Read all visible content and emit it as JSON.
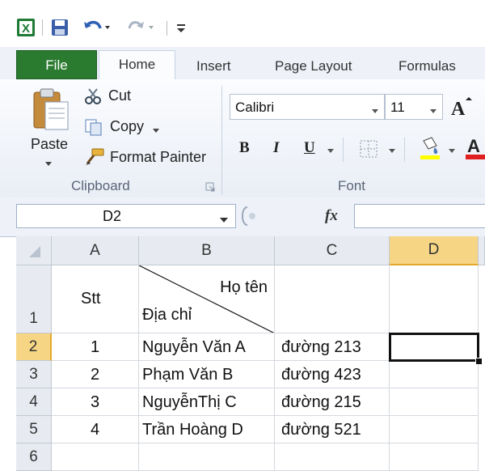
{
  "quick_access": {
    "icons": [
      "excel-icon",
      "save-icon",
      "undo-icon",
      "redo-icon",
      "customize-icon"
    ]
  },
  "tabs": [
    {
      "label": "File"
    },
    {
      "label": "Home"
    },
    {
      "label": "Insert"
    },
    {
      "label": "Page Layout"
    },
    {
      "label": "Formulas"
    }
  ],
  "ribbon": {
    "clipboard": {
      "paste": "Paste",
      "cut": "Cut",
      "copy": "Copy",
      "format_painter": "Format Painter",
      "label": "Clipboard"
    },
    "font": {
      "name": "Calibri",
      "size": "11",
      "bold": "B",
      "italic": "I",
      "underline": "U",
      "label": "Font"
    }
  },
  "formula_bar": {
    "name_box": "D2",
    "fx": "fx",
    "value": ""
  },
  "sheet": {
    "columns": [
      "A",
      "B",
      "C",
      "D"
    ],
    "rows": [
      "1",
      "2",
      "3",
      "4",
      "5",
      "6"
    ],
    "header_row": {
      "stt": "Stt",
      "ho_ten": "Họ tên",
      "dia_chi": "Địa chỉ",
      "c": "",
      "d": ""
    },
    "data": [
      {
        "stt": "1",
        "name": "Nguyễn Văn A",
        "address": "đường 213"
      },
      {
        "stt": "2",
        "name": "Phạm Văn B",
        "address": "đường 423"
      },
      {
        "stt": "3",
        "name": "NguyễnThị C",
        "address": "đường 215"
      },
      {
        "stt": "4",
        "name": "Trần Hoàng D",
        "address": "đường 521"
      }
    ],
    "selected_cell": "D2"
  },
  "colors": {
    "file_tab": "#2a7a30",
    "selected_header": "#f6d585",
    "excel_green": "#1e7a34"
  }
}
